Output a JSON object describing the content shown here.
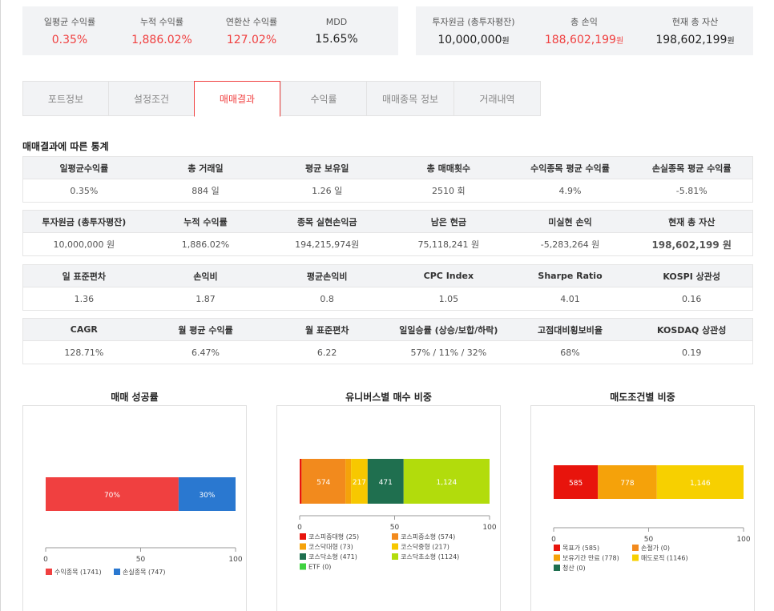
{
  "summary_left": [
    {
      "label": "일평균 수익률",
      "value": "0.35%"
    },
    {
      "label": "누적 수익률",
      "value": "1,886.02%"
    },
    {
      "label": "연환산 수익률",
      "value": "127.02%"
    },
    {
      "label": "MDD",
      "value": "15.65%"
    }
  ],
  "summary_right": [
    {
      "label": "투자원금 (총투자평잔)",
      "value": "10,000,000",
      "unit": "원"
    },
    {
      "label": "총 손익",
      "value": "188,602,199",
      "unit": "원"
    },
    {
      "label": "현재 총 자산",
      "value": "198,602,199",
      "unit": "원"
    }
  ],
  "tabs": [
    "포트정보",
    "설정조건",
    "매매결과",
    "수익률",
    "매매종목 정보",
    "거래내역"
  ],
  "active_tab": "매매결과",
  "section_title": "매매결과에 따른 통계",
  "stats": [
    {
      "headers": [
        "일평균수익률",
        "총 거래일",
        "평균 보유일",
        "총 매매횟수",
        "수익종목 평균 수익률",
        "손실종목 평균 수익률"
      ],
      "values": [
        "0.35%",
        "884 일",
        "1.26 일",
        "2510 회",
        "4.9%",
        "-5.81%"
      ]
    },
    {
      "headers": [
        "투자원금 (총투자평잔)",
        "누적 수익률",
        "종목 실현손익금",
        "남은 현금",
        "미실현 손익",
        "현재 총 자산"
      ],
      "values": [
        "10,000,000 원",
        "1,886.02%",
        "194,215,974원",
        "75,118,241 원",
        "-5,283,264 원",
        "198,602,199 원"
      ]
    },
    {
      "headers": [
        "일 표준편차",
        "손익비",
        "평균손익비",
        "CPC Index",
        "Sharpe Ratio",
        "KOSPI 상관성"
      ],
      "values": [
        "1.36",
        "1.87",
        "0.8",
        "1.05",
        "4.01",
        "0.16"
      ]
    },
    {
      "headers": [
        "CAGR",
        "월 평균 수익률",
        "월 표준편차",
        "일일승률 (상승/보합/하락)",
        "고점대비횡보비율",
        "KOSDAQ 상관성"
      ],
      "values": [
        "128.71%",
        "6.47%",
        "6.22",
        "57% / 11% / 32%",
        "68%",
        "0.19"
      ]
    }
  ],
  "colors": {
    "red": "#f04040",
    "blue": "#3a7bd5",
    "panel": "#f2f3f5"
  },
  "chart_data": [
    {
      "type": "bar",
      "stacked": true,
      "orientation": "horizontal",
      "title": "매매 성공률",
      "xlim": [
        0,
        100
      ],
      "xticks": [
        "0",
        "50",
        "100"
      ],
      "series": [
        {
          "name": "수익종목 (1741)",
          "value": 70,
          "label": "70%",
          "color": "#f04040"
        },
        {
          "name": "손실종목 (747)",
          "value": 30,
          "label": "30%",
          "color": "#2a78d0"
        }
      ]
    },
    {
      "type": "bar",
      "stacked": true,
      "orientation": "horizontal",
      "title": "유니버스별 매수 비중",
      "xlim": [
        0,
        100
      ],
      "xticks": [
        "0",
        "50",
        "100"
      ],
      "series": [
        {
          "name": "코스피중대형 (25)",
          "value": 25,
          "label": "",
          "color": "#e8140c"
        },
        {
          "name": "코스피중소형 (574)",
          "value": 574,
          "label": "574",
          "color": "#f28a1d"
        },
        {
          "name": "코스닥대형 (73)",
          "value": 73,
          "label": "",
          "color": "#f5a20a"
        },
        {
          "name": "코스닥중형 (217)",
          "value": 217,
          "label": "217",
          "color": "#f7c800"
        },
        {
          "name": "코스닥소형 (471)",
          "value": 471,
          "label": "471",
          "color": "#1f6f4f"
        },
        {
          "name": "코스닥초소형 (1124)",
          "value": 1124,
          "label": "1,124",
          "color": "#b2dc0c"
        },
        {
          "name": "ETF (0)",
          "value": 0,
          "label": "",
          "color": "#3fd23f"
        }
      ]
    },
    {
      "type": "bar",
      "stacked": true,
      "orientation": "horizontal",
      "title": "매도조건별 비중",
      "xlim": [
        0,
        100
      ],
      "xticks": [
        "0",
        "50",
        "100"
      ],
      "series": [
        {
          "name": "목표가 (585)",
          "value": 585,
          "label": "585",
          "color": "#e8140c"
        },
        {
          "name": "손절가 (0)",
          "value": 0,
          "label": "",
          "color": "#f28a1d"
        },
        {
          "name": "보유기간 만료 (778)",
          "value": 778,
          "label": "778",
          "color": "#f5a20a"
        },
        {
          "name": "매도로직 (1146)",
          "value": 1146,
          "label": "1,146",
          "color": "#f7d000"
        },
        {
          "name": "청산 (0)",
          "value": 0,
          "label": "",
          "color": "#1f6f4f"
        }
      ]
    }
  ]
}
